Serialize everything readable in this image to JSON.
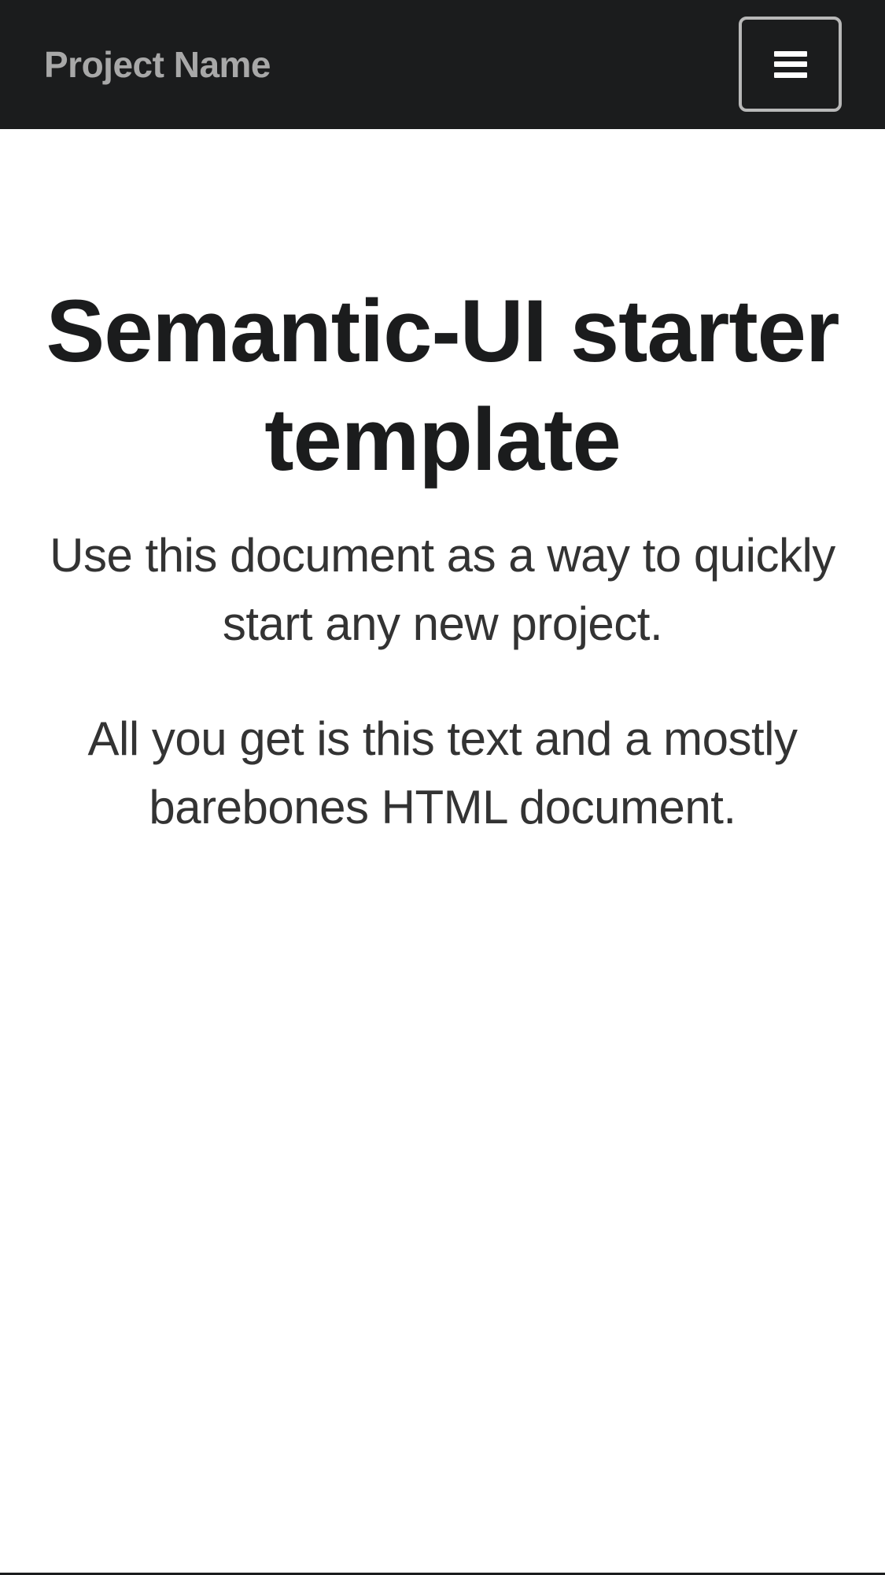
{
  "navbar": {
    "brand": "Project Name",
    "menu_toggle_icon": "hamburger-icon"
  },
  "hero": {
    "title": "Semantic-UI starter template",
    "lead_1": "Use this document as a way to quickly start any new project.",
    "lead_2": "All you get is this text and a mostly barebones HTML document."
  },
  "colors": {
    "navbar_bg": "#1b1c1d",
    "brand_text": "#a8a8a8",
    "title_text": "#1b1c1d",
    "lead_text": "#333333",
    "page_bg": "#ffffff"
  }
}
